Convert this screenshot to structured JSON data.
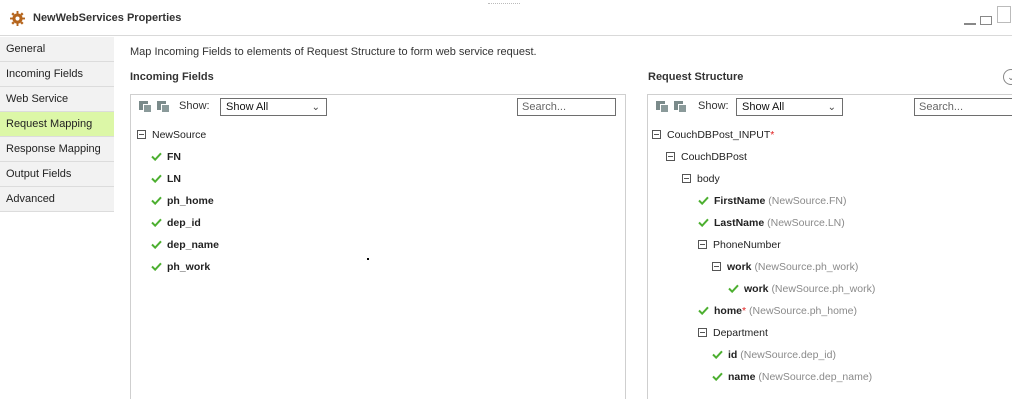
{
  "window": {
    "title": "NewWebServices Properties"
  },
  "sidebar": {
    "items": [
      {
        "label": "General"
      },
      {
        "label": "Incoming Fields"
      },
      {
        "label": "Web Service"
      },
      {
        "label": "Request Mapping"
      },
      {
        "label": "Response Mapping"
      },
      {
        "label": "Output Fields"
      },
      {
        "label": "Advanced"
      }
    ],
    "active": "Request Mapping"
  },
  "main": {
    "description": "Map Incoming Fields to elements of Request Structure to form web service request.",
    "incoming": {
      "title": "Incoming Fields",
      "show_label": "Show:",
      "show_value": "Show All",
      "search_placeholder": "Search...",
      "tree": {
        "root": "NewSource",
        "fields": [
          "FN",
          "LN",
          "ph_home",
          "dep_id",
          "dep_name",
          "ph_work"
        ]
      }
    },
    "request": {
      "title": "Request Structure",
      "show_label": "Show:",
      "show_value": "Show All",
      "search_placeholder": "Search...",
      "tree": {
        "root": "CouchDBPost_INPUT",
        "root_required": "*",
        "child": "CouchDBPost",
        "body": "body",
        "firstname": {
          "name": "FirstName",
          "source": "(NewSource.FN)"
        },
        "lastname": {
          "name": "LastName",
          "source": "(NewSource.LN)"
        },
        "phone": "PhoneNumber",
        "work_group": {
          "name": "work",
          "source": "(NewSource.ph_work)"
        },
        "work_leaf": {
          "name": "work",
          "source": "(NewSource.ph_work)"
        },
        "home": {
          "name": "home",
          "required": "*",
          "source": "(NewSource.ph_home)"
        },
        "department": "Department",
        "id": {
          "name": "id",
          "source": "(NewSource.dep_id)"
        },
        "dname": {
          "name": "name",
          "source": "(NewSource.dep_name)"
        }
      }
    }
  },
  "colors": {
    "active_tab": "#dcf7a7",
    "check": "#4caf30",
    "required": "#e02020"
  }
}
